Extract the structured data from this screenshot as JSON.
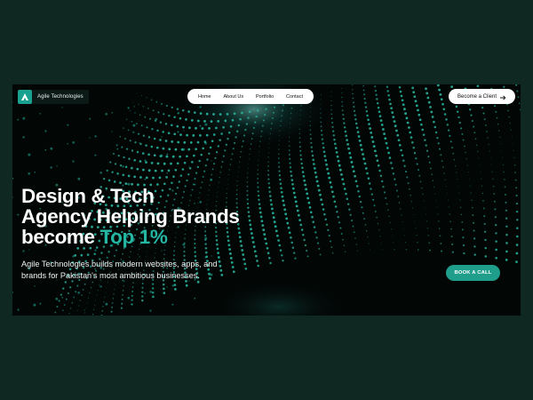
{
  "brand": {
    "name": "Agile Technologies"
  },
  "nav": {
    "items": [
      "Home",
      "About Us",
      "Portfolio",
      "Contact"
    ]
  },
  "header_cta": {
    "label": "Become a Client",
    "icon": "arrow-right-icon"
  },
  "hero": {
    "headline_line1": "Design & Tech",
    "headline_line2": "Agency Helping Brands",
    "headline_line3_prefix": "become",
    "headline_line3_accent": "Top 1%",
    "subtext": "Agile Technologies builds modern websites, apps, and brands for Pakistan's most ambitious businesses.",
    "book_button": "BOOK A CALL"
  },
  "colors": {
    "page_bg": "#102822",
    "hero_bg": "#020605",
    "accent": "#24b7a4",
    "button": "#1f9e8c"
  }
}
